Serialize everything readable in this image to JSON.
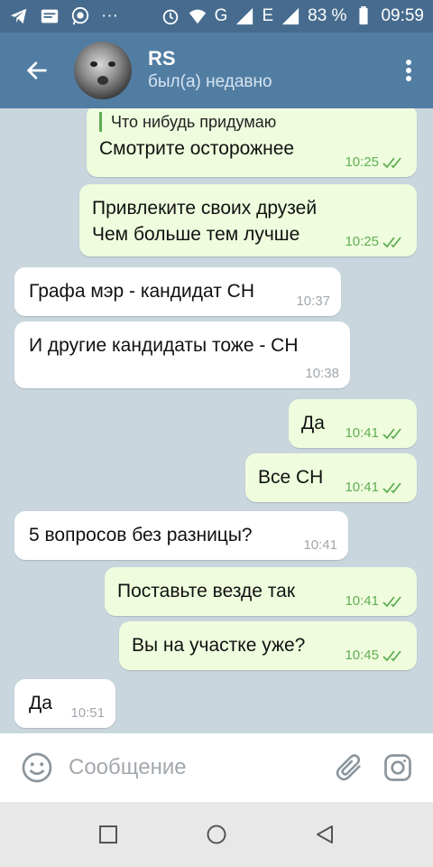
{
  "status_bar": {
    "network": "G",
    "network2": "E",
    "battery": "83 %",
    "time": "09:59"
  },
  "header": {
    "name": "RS",
    "status": "был(а) недавно"
  },
  "messages": [
    {
      "dir": "out",
      "reply": "Что нибудь придумаю",
      "text": "Смотрите осторожнее",
      "time": "10:25"
    },
    {
      "dir": "out",
      "text": "Привлеките своих друзей\nЧем больше тем лучше",
      "time": "10:25"
    },
    {
      "dir": "in",
      "text": "Графа мэр - кандидат СН",
      "time": "10:37"
    },
    {
      "dir": "in",
      "text": "И другие кандидаты тоже - СН",
      "time": "10:38"
    },
    {
      "dir": "out",
      "text": "Да",
      "time": "10:41"
    },
    {
      "dir": "out",
      "text": "Все СН",
      "time": "10:41"
    },
    {
      "dir": "in",
      "text": "5 вопросов без разницы?",
      "time": "10:41"
    },
    {
      "dir": "out",
      "text": "Поставьте везде так",
      "time": "10:41"
    },
    {
      "dir": "out",
      "text": "Вы на участке уже?",
      "time": "10:45"
    },
    {
      "dir": "in",
      "text": "Да",
      "time": "10:51"
    }
  ],
  "input": {
    "placeholder": "Сообщение"
  },
  "colors": {
    "header": "#527da3",
    "status_bar": "#466b8e",
    "outgoing_bubble": "#effdde",
    "incoming_bubble": "#ffffff",
    "read_check": "#5fae53"
  }
}
